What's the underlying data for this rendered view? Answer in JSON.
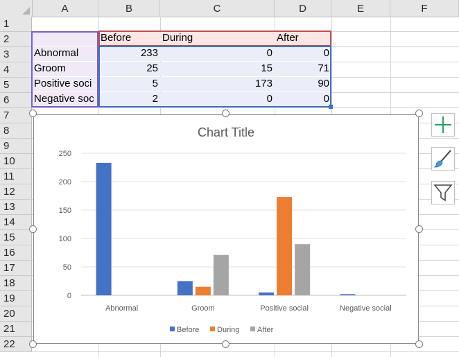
{
  "columns": [
    "A",
    "B",
    "C",
    "D",
    "E",
    "F"
  ],
  "rows": [
    "1",
    "2",
    "3",
    "4",
    "5",
    "6",
    "7",
    "8",
    "9",
    "10",
    "11",
    "12",
    "13",
    "14",
    "15",
    "16",
    "17",
    "18",
    "19",
    "20",
    "21",
    "22"
  ],
  "table": {
    "header": [
      "",
      "Before",
      "During",
      "After"
    ],
    "body": [
      [
        "Abnormal",
        "233",
        "0",
        "0"
      ],
      [
        "Groom",
        "25",
        "15",
        "71"
      ],
      [
        "Positive soci",
        "5",
        "173",
        "90"
      ],
      [
        "Negative soc",
        "2",
        "0",
        "0"
      ]
    ]
  },
  "chart_data": {
    "type": "bar",
    "title": "Chart Title",
    "categories": [
      "Abnormal",
      "Groom",
      "Positive social",
      "Negative social"
    ],
    "series": [
      {
        "name": "Before",
        "values": [
          233,
          25,
          5,
          2
        ],
        "color": "#4472c4"
      },
      {
        "name": "During",
        "values": [
          0,
          15,
          173,
          0
        ],
        "color": "#ed7d31"
      },
      {
        "name": "After",
        "values": [
          0,
          71,
          90,
          0
        ],
        "color": "#a5a5a5"
      }
    ],
    "yticks": [
      0,
      50,
      100,
      150,
      200,
      250
    ],
    "ylim": [
      0,
      250
    ],
    "grid": true,
    "legend_position": "bottom"
  },
  "side_buttons": [
    "chart-elements-icon",
    "chart-styles-icon",
    "chart-filters-icon"
  ],
  "colors": {
    "header_fill": "#e6e6e6",
    "header_series_fill": "#fbe5e5",
    "data_fill": "#e9eef9",
    "label_fill": "#f0eaf7",
    "range_purple": "#7f5fc9",
    "range_red": "#c0504d",
    "range_blue": "#4472c4",
    "add_green": "#21a366"
  }
}
